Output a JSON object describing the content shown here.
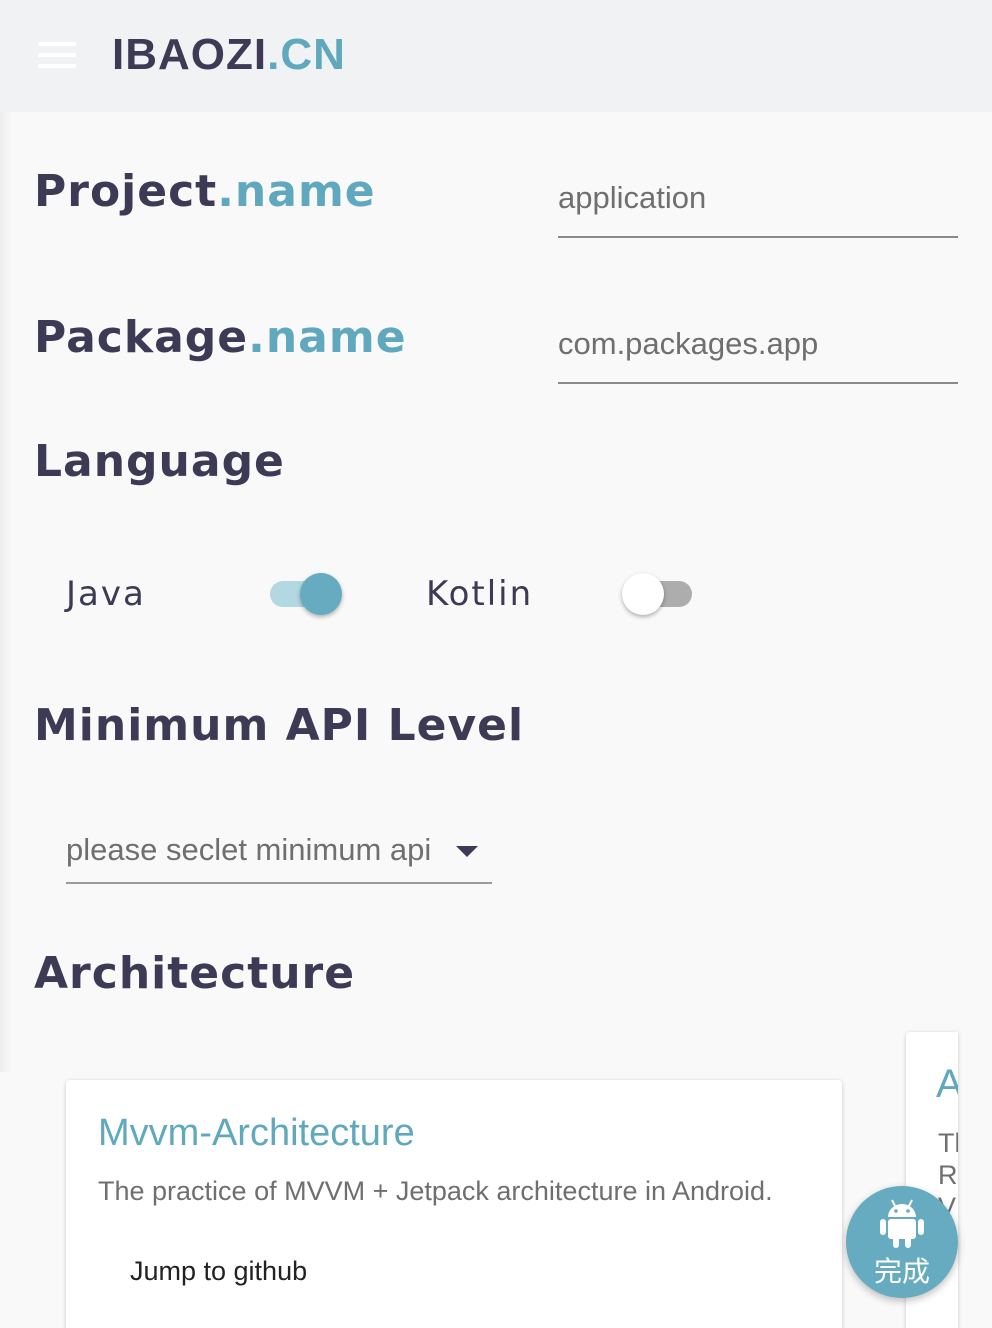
{
  "header": {
    "brand_main": "IBAOZI",
    "brand_accent": ".CN",
    "menu_icon": "menu-icon"
  },
  "project": {
    "label_main": "Project",
    "label_accent": ".name",
    "value": "application"
  },
  "package": {
    "label_main": "Package",
    "label_accent": ".name",
    "value": "com.packages.app"
  },
  "language": {
    "title": "Language",
    "options": [
      {
        "label": "Java",
        "checked": true
      },
      {
        "label": "Kotlin",
        "checked": false
      }
    ]
  },
  "api": {
    "title": "Minimum API Level",
    "placeholder": "please seclet minimum api"
  },
  "architecture": {
    "title": "Architecture",
    "cards": [
      {
        "title": "Mvvm-Architecture",
        "description": "The practice of MVVM + Jetpack architecture in Android.",
        "link": "Jump to github"
      },
      {
        "title": "A",
        "lines": [
          "Tl",
          "R",
          "V"
        ]
      }
    ]
  },
  "fab": {
    "icon": "android-icon",
    "label": "完成"
  },
  "colors": {
    "accent": "#5fa8bd",
    "text": "#3c3a55",
    "switch_on_track": "#b3d8e2",
    "switch_off_track": "#adadad",
    "fab": "#66abbf"
  }
}
